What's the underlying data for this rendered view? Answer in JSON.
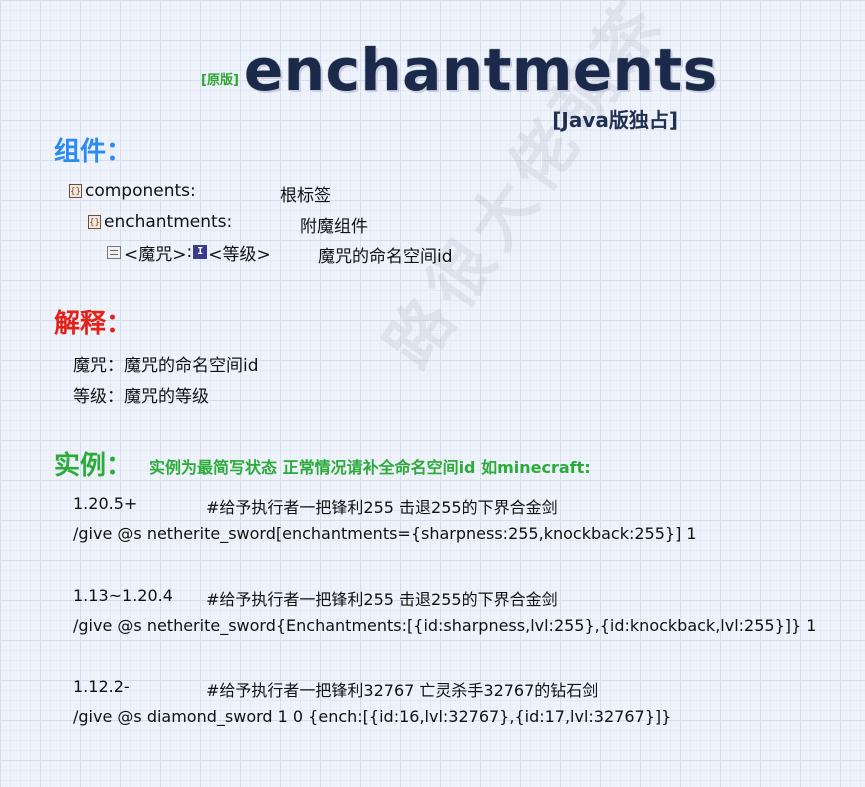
{
  "header": {
    "tag": "[原版]",
    "title": "enchantments",
    "edition": "[Java版独占]"
  },
  "components_section": {
    "heading": "组件：",
    "rows": [
      {
        "label": "components:",
        "desc": "根标签"
      },
      {
        "label": "enchantments:",
        "desc": "附魔组件"
      },
      {
        "key": "<魔咒>",
        "sep": ":",
        "int_icon": "I",
        "value": "<等级>",
        "desc": "魔咒的命名空间id"
      }
    ]
  },
  "explain_section": {
    "heading": "解释：",
    "lines": [
      "魔咒：魔咒的命名空间id",
      "等级：魔咒的等级"
    ]
  },
  "example_section": {
    "heading": "实例：",
    "note": "实例为最简写状态 正常情况请补全命名空间id 如minecraft:",
    "examples": [
      {
        "version": "1.20.5+",
        "comment": "#给予执行者一把锋利255 击退255的下界合金剑",
        "command": "/give @s netherite_sword[enchantments={sharpness:255,knockback:255}] 1"
      },
      {
        "version": "1.13~1.20.4",
        "comment": "#给予执行者一把锋利255 击退255的下界合金剑",
        "command": "/give @s netherite_sword{Enchantments:[{id:sharpness,lvl:255},{id:knockback,lvl:255}]} 1"
      },
      {
        "version": "1.12.2-",
        "comment": "#给予执行者一把锋利32767 亡灵杀手32767的钻石剑",
        "command": "/give @s diamond_sword 1 0 {ench:[{id:16,lvl:32767},{id:17,lvl:32767}]}"
      }
    ]
  },
  "watermark": "路很大佬萌茶",
  "icons": {
    "compound": "compound-tag-icon",
    "any": "any-tag-icon",
    "int": "int-tag-icon"
  },
  "colors": {
    "title": "#1b2a4a",
    "components_heading": "#2a8cf0",
    "explain_heading": "#e2231a",
    "example_heading": "#2cab3a"
  }
}
